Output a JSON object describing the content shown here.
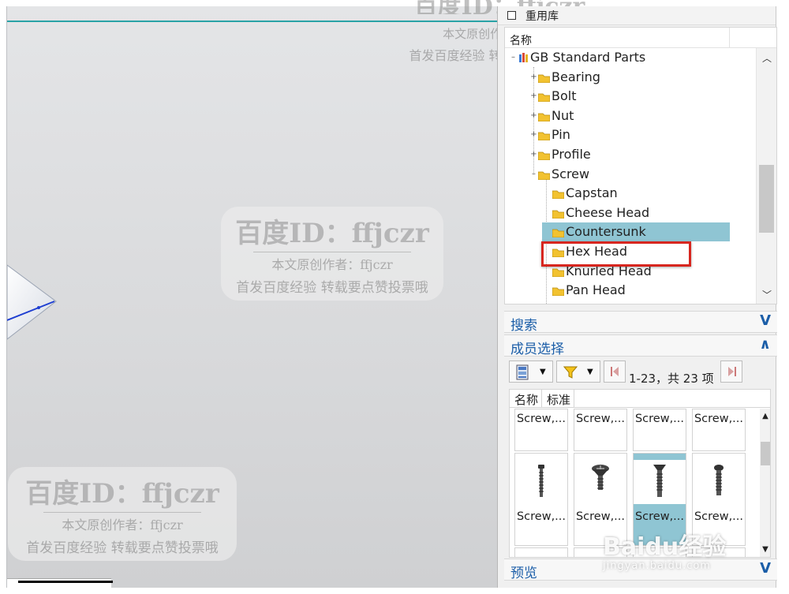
{
  "panel": {
    "title": "重用库",
    "tree_header": "名称",
    "tree": [
      {
        "label": "GB Standard Parts",
        "level": 0,
        "expander": "-"
      },
      {
        "label": "Bearing",
        "level": 1,
        "expander": "+"
      },
      {
        "label": "Bolt",
        "level": 1,
        "expander": "+"
      },
      {
        "label": "Nut",
        "level": 1,
        "expander": "+"
      },
      {
        "label": "Pin",
        "level": 1,
        "expander": "+"
      },
      {
        "label": "Profile",
        "level": 1,
        "expander": "+"
      },
      {
        "label": "Screw",
        "level": 1,
        "expander": "-"
      },
      {
        "label": "Capstan",
        "level": 2,
        "expander": ""
      },
      {
        "label": "Cheese Head",
        "level": 2,
        "expander": ""
      },
      {
        "label": "Countersunk",
        "level": 2,
        "expander": "",
        "selected": true
      },
      {
        "label": "Hex Head",
        "level": 2,
        "expander": ""
      },
      {
        "label": "Knurled Head",
        "level": 2,
        "expander": ""
      },
      {
        "label": "Pan Head",
        "level": 2,
        "expander": ""
      }
    ],
    "search_section": "搜索",
    "member_section": "成员选择",
    "preview_section": "预览",
    "member": {
      "range_text": "1-23，共 23 项",
      "tabs": [
        "名称",
        "标准"
      ],
      "row1_captions": [
        "Screw,...",
        "Screw,...",
        "Screw,...",
        "Screw,..."
      ],
      "row2_captions": [
        "Screw,...",
        "Screw,...",
        "Screw,...",
        "Screw,..."
      ],
      "selected_index": 2
    }
  },
  "watermarks": {
    "big": "百度ID：ffjczr",
    "author": "本文原创作者：ffjczr",
    "note": "首发百度经验 转载要点赞投票哦"
  },
  "baidu": {
    "logo": "Baidu经验",
    "url": "jingyan.baidu.com"
  },
  "colors": {
    "accent_blue": "#1b5ea8",
    "selection": "#8fc5d3",
    "highlight_red": "#d7261f",
    "viewport_line": "#2aa3a6"
  }
}
